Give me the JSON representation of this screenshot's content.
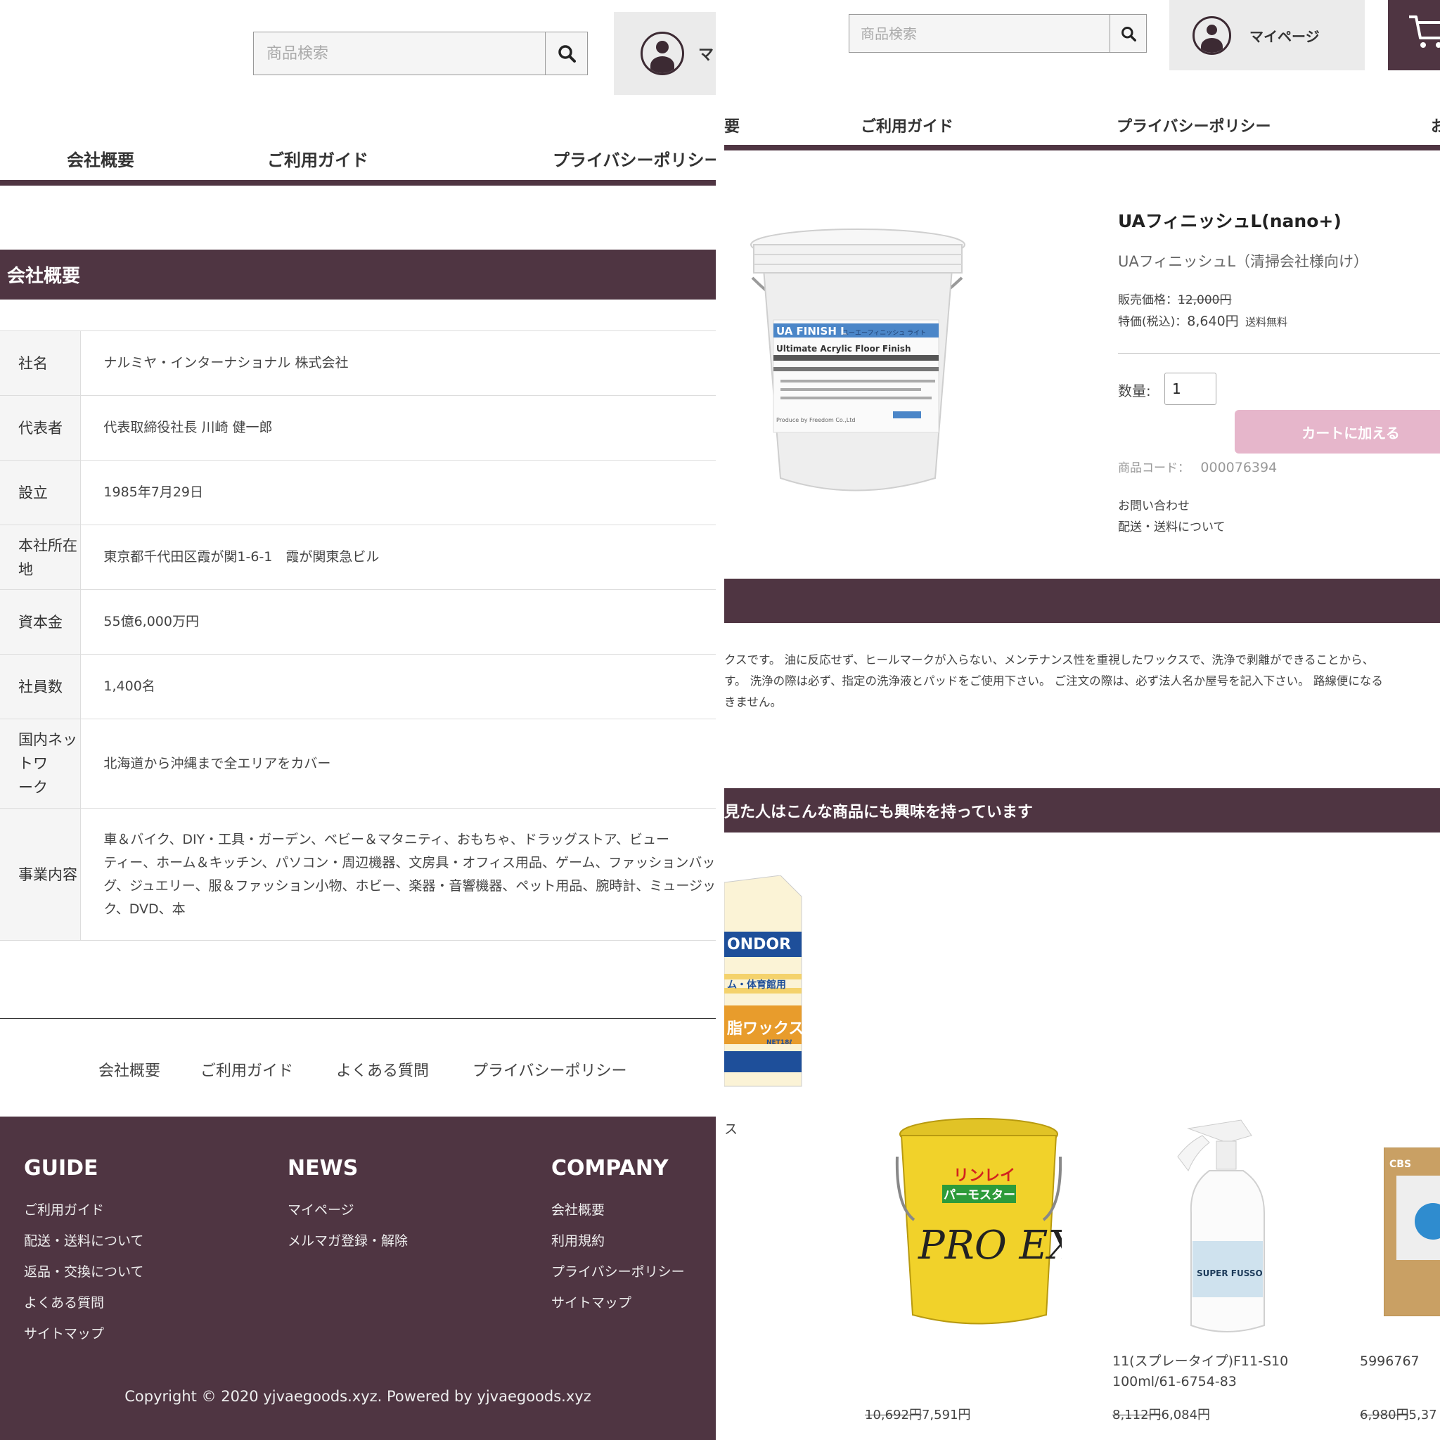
{
  "left": {
    "search": {
      "placeholder": "商品検索"
    },
    "mypage": {
      "label_partial": "マ"
    },
    "nav": [
      "会社概要",
      "ご利用ガイド",
      "プライバシーポリシー"
    ],
    "section_title": "会社概要",
    "company_table": [
      {
        "label": "社名",
        "value": "ナルミヤ・インターナショナル 株式会社"
      },
      {
        "label": "代表者",
        "value": "代表取締役社長 川崎 健一郎"
      },
      {
        "label": "設立",
        "value": "1985年7月29日"
      },
      {
        "label": "本社所在地",
        "value": "東京都千代田区霞が関1-6-1　霞が関東急ビル"
      },
      {
        "label": "資本金",
        "value": "55億6,000万円"
      },
      {
        "label": "社員数",
        "value": "1,400名"
      },
      {
        "label_lines": [
          "国内ネットワ",
          "ーク"
        ],
        "value": "北海道から沖縄まで全エリアをカバー"
      },
      {
        "label": "事業内容",
        "value_lines": [
          "車＆バイク、DIY・工具・ガーデン、ベビー＆マタニティ、おもちゃ、ドラッグストア、ビュー",
          "ティー、ホーム＆キッチン、パソコン・周辺機器、文房具・オフィス用品、ゲーム、ファッションバッ",
          "グ、ジュエリー、服＆ファッション小物、ホビー、楽器・音響機器、ペット用品、腕時計、ミュージッ",
          "ク、DVD、本"
        ]
      }
    ],
    "footer_links": [
      "会社概要",
      "ご利用ガイド",
      "よくある質問",
      "プライバシーポリシー"
    ],
    "footer": {
      "guide": {
        "title": "GUIDE",
        "items": [
          "ご利用ガイド",
          "配送・送料について",
          "返品・交換について",
          "よくある質問",
          "サイトマップ"
        ]
      },
      "news": {
        "title": "NEWS",
        "items": [
          "マイページ",
          "メルマガ登録・解除"
        ]
      },
      "company": {
        "title": "COMPANY",
        "items": [
          "会社概要",
          "利用規約",
          "プライバシーポリシー",
          "サイトマップ"
        ]
      },
      "copyright": "Copyright © 2020 yjvaegoods.xyz. Powered by yjvaegoods.xyz"
    }
  },
  "right": {
    "search": {
      "placeholder": "商品検索"
    },
    "mypage": {
      "label": "マイページ"
    },
    "nav": [
      "要",
      "ご利用ガイド",
      "プライバシーポリシー",
      "お"
    ],
    "product": {
      "title": "UAフィニッシュL(nano+)",
      "subtitle": "UAフィニッシュL（清掃会社様向け）",
      "price_label": "販売価格：",
      "price_regular": "12,000円",
      "special_label": "特価(税込)：",
      "special_price": "8,640円",
      "shipping": "送料無料",
      "qty_label": "数量:",
      "qty_value": "1",
      "cart_button": "カートに加える",
      "code_label": "商品コード：",
      "code_value": "000076394",
      "link_inquiry": "お問い合わせ",
      "link_shipping": "配送・送料について",
      "image_text": {
        "brand": "UA FINISH L",
        "brand_kana": "ユーエーフィニッシュ ライト",
        "subtitle": "Ultimate Acrylic Floor Finish",
        "maker": "Produce by Freedom Co.,Ltd"
      }
    },
    "description_lines": [
      "クスです。 油に反応せず、ヒールマークが入らない、メンテナンス性を重視したワックスで、洗浄で剥離ができることから、",
      "す。 洗浄の際は必ず、指定の洗浄液とパッドをご使用下さい。 ご注文の際は、必ず法人名か屋号を記入下さい。 路線便になる",
      "きません。"
    ],
    "recommend_title": "見た人はこんな商品にも興味を持っています",
    "recommend_left_caption": "ス",
    "recommend": [
      {
        "caption": "",
        "price_old": "10,692円",
        "price_new": "7,591円",
        "img": {
          "brand": "リンレイ",
          "name": "パーモスター",
          "text": "PRO EX"
        }
      },
      {
        "caption_lines": [
          "11(スプレータイプ)F11-S10",
          "100ml/61-6754-83"
        ],
        "price_old": "8,112円",
        "price_new": "6,084円",
        "img": {
          "text": "SUPER FUSSO"
        }
      },
      {
        "caption_lines": [
          "5996767"
        ],
        "price_old": "6,980円",
        "price_new": "5,37",
        "img": {
          "brand": "CBS"
        }
      }
    ],
    "recommend_box_text": {
      "top": "ONDOR",
      "mid": "ム・体育館用",
      "big": "脂ワックス",
      "net": "NET18ℓ"
    }
  },
  "colors": {
    "brand": "#4f3542",
    "cart_button": "#e6b6cb",
    "pail_yellow": "#f1d22a"
  }
}
